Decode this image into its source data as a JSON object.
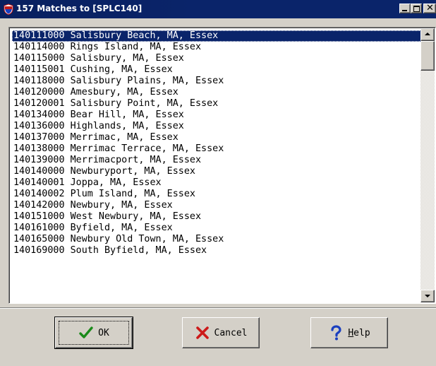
{
  "window": {
    "title": "157 Matches to [SPLC140]",
    "title_icon": "shield-icon",
    "controls": {
      "minimize_icon": "minimize-icon",
      "maximize_icon": "maximize-icon",
      "close_glyph": "✕"
    }
  },
  "list": {
    "selected_index": 0,
    "items": [
      "140111000 Salisbury Beach, MA, Essex",
      "140114000 Rings Island, MA, Essex",
      "140115000 Salisbury, MA, Essex",
      "140115001 Cushing, MA, Essex",
      "140118000 Salisbury Plains, MA, Essex",
      "140120000 Amesbury, MA, Essex",
      "140120001 Salisbury Point, MA, Essex",
      "140134000 Bear Hill, MA, Essex",
      "140136000 Highlands, MA, Essex",
      "140137000 Merrimac, MA, Essex",
      "140138000 Merrimac Terrace, MA, Essex",
      "140139000 Merrimacport, MA, Essex",
      "140140000 Newburyport, MA, Essex",
      "140140001 Joppa, MA, Essex",
      "140140002 Plum Island, MA, Essex",
      "140142000 Newbury, MA, Essex",
      "140151000 West Newbury, MA, Essex",
      "140161000 Byfield, MA, Essex",
      "140165000 Newbury Old Town, MA, Essex",
      "140169000 South Byfield, MA, Essex"
    ]
  },
  "buttons": {
    "ok": {
      "label": "OK",
      "icon": "checkmark-icon",
      "color": "#1a8a1a"
    },
    "cancel": {
      "label": "Cancel",
      "icon": "x-mark-icon",
      "color": "#cc1a1a"
    },
    "help": {
      "label_prefix": "",
      "label_mnemonic": "H",
      "label_rest": "elp",
      "icon": "question-mark-icon",
      "color": "#1a3fbf"
    }
  }
}
